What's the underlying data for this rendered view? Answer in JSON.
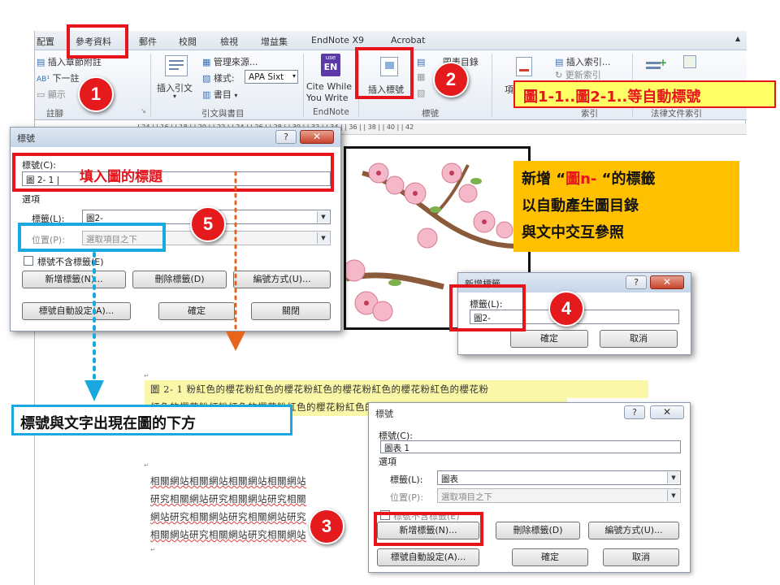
{
  "ribbon": {
    "tabs": [
      "配置",
      "參考資料",
      "郵件",
      "校閱",
      "檢視",
      "增益集",
      "EndNote X9",
      "Acrobat"
    ],
    "items": {
      "insert_endnote": "插入章節附註",
      "next_footnote": "下一註",
      "show_notes": "顯示",
      "insert_citation": "插入引文",
      "manage_sources": "管理來源...",
      "style_label": "樣式:",
      "style_value": "APA Sixt",
      "bibliography": "書目",
      "cite_while_line1": "Cite While",
      "cite_while_line2": "You Write",
      "insert_caption": "插入標號",
      "insert_table_of_figures": "圖表目錄",
      "insert_index": "插入索引...",
      "update_index": "更新索引",
      "mark_entry": "項",
      "endnote_icon_text_1": "use",
      "endnote_icon_text_2": "EN"
    },
    "groups": {
      "footnotes": "註腳",
      "citations": "引文與書目",
      "endnote": "EndNote",
      "captions": "標號",
      "index": "索引",
      "authorities": "法律文件索引"
    }
  },
  "ruler_text": "| 24 |  | 16 |  | 18 |  | 20 |  | 22 |  | 24 |  | 26 |  | 28 |  | 30 |  | 32 |  | 34 |  | 36 |  | 38 |  | 40 |  | 42",
  "caption_dialog_main": {
    "title": "標號",
    "help": "?",
    "close": "✕",
    "caption_label": "標號(C):",
    "caption_value": "圖 2- 1",
    "options_label": "選項",
    "label_label": "標籤(L):",
    "label_value": "圖2-",
    "position_label": "位置(P):",
    "position_value": "選取項目之下",
    "exclude_label": "標號不含標籤(E)",
    "new_label_button": "新增標籤(N)...",
    "delete_label_button": "刪除標籤(D)",
    "numbering_button": "編號方式(U)...",
    "autocaption_button": "標號自動設定(A)...",
    "ok_button": "確定",
    "close_button": "關閉"
  },
  "new_label_dialog": {
    "title": "新增標籤",
    "help": "?",
    "close": "✕",
    "label_label": "標籤(L):",
    "label_value": "圖2-",
    "ok_button": "確定",
    "cancel_button": "取消"
  },
  "caption_dialog_small": {
    "title": "標號",
    "help": "?",
    "close": "✕",
    "caption_label": "標號(C):",
    "caption_value": "圖表 1",
    "options_label": "選項",
    "label_label": "標籤(L):",
    "label_value": "圖表",
    "position_label": "位置(P):",
    "position_value": "選取項目之下",
    "exclude_label": "標號不含標籤(E)",
    "new_label_button": "新增標籤(N)...",
    "delete_label_button": "刪除標籤(D)",
    "numbering_button": "編號方式(U)...",
    "autocaption_button": "標號自動設定(A)...",
    "ok_button": "確定",
    "cancel_button": "取消"
  },
  "document": {
    "caption_line1": "圖 2- 1 粉紅色的櫻花粉紅色的櫻花粉紅色的櫻花粉紅色的櫻花粉紅色的櫻花粉",
    "caption_line2": "紅色的櫻花粉紅粉紅色的櫻花粉紅色的櫻花粉紅色的櫻花色的櫻花",
    "para_lines": [
      "相關網站相關網站相關網站相關網站",
      "研究相關網站研究相關網站研究相關",
      "網站研究相關網站研究相關網站研究",
      "相關網站研究相關網站研究相關網站"
    ]
  },
  "annotations": {
    "badges": [
      "1",
      "2",
      "3",
      "4",
      "5"
    ],
    "fill_title": "填入圖的標題",
    "auto_number": "圖1-1..圖2-1..等自動標號",
    "new_label_line1_prefix": "新增 “",
    "new_label_line1_red": "圖n-",
    "new_label_line1_suffix": " “的標籤",
    "new_label_line2": "以自動產生圖目錄",
    "new_label_line3": "與文中交互參照",
    "below_figure": "標號與文字出現在圖的下方",
    "colors": {
      "red": "#e8141c",
      "blue": "#1aa8e0",
      "yellow": "#ffc000",
      "orange_dots": "#e8641c"
    }
  }
}
